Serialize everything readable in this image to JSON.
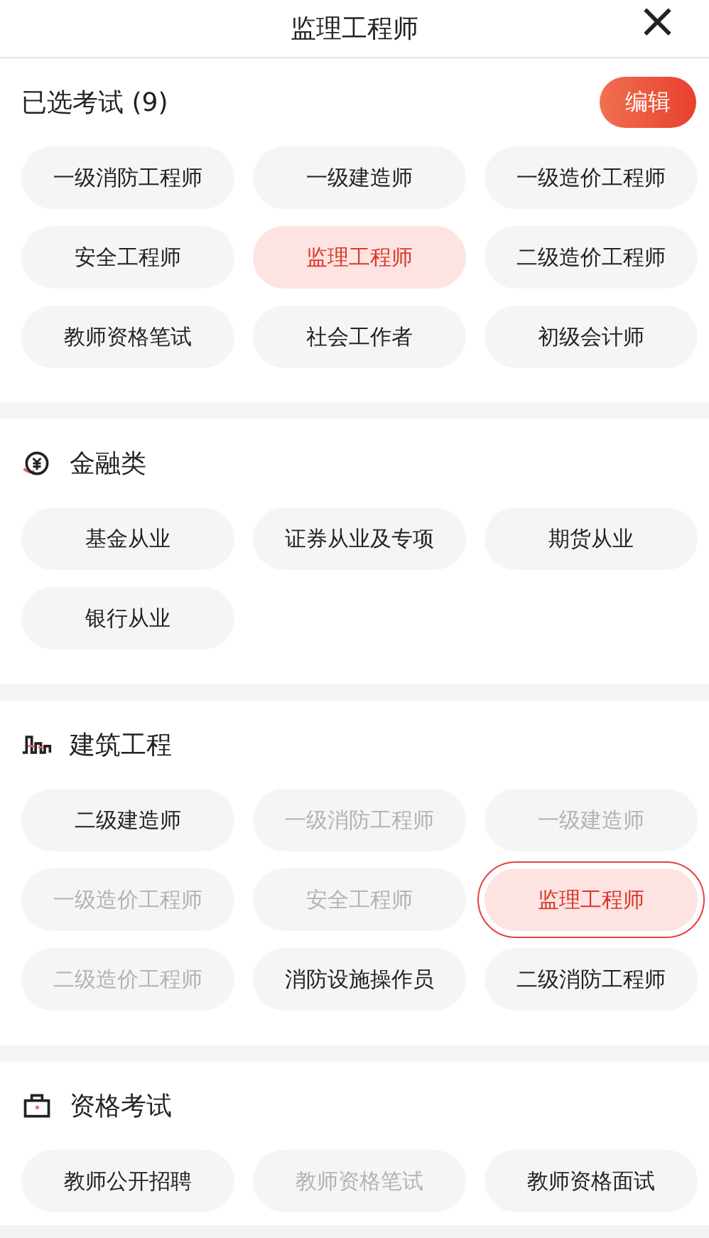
{
  "header": {
    "title": "监理工程师",
    "close": "×"
  },
  "chosen": {
    "title": "已选考试 (9)",
    "edit_button": "编辑",
    "items": [
      {
        "label": "一级消防工程师",
        "selected": false
      },
      {
        "label": "一级建造师",
        "selected": false
      },
      {
        "label": "一级造价工程师",
        "selected": false
      },
      {
        "label": "安全工程师",
        "selected": false
      },
      {
        "label": "监理工程师",
        "selected": true
      },
      {
        "label": "二级造价工程师",
        "selected": false
      },
      {
        "label": "教师资格笔试",
        "selected": false
      },
      {
        "label": "社会工作者",
        "selected": false
      },
      {
        "label": "初级会计师",
        "selected": false
      }
    ]
  },
  "categories": [
    {
      "title": "金融类",
      "kind": "finance",
      "items": [
        {
          "label": "基金从业",
          "selected": false,
          "disabled": false,
          "outlined": false
        },
        {
          "label": "证券从业及专项",
          "selected": false,
          "disabled": false,
          "outlined": false
        },
        {
          "label": "期货从业",
          "selected": false,
          "disabled": false,
          "outlined": false
        },
        {
          "label": "银行从业",
          "selected": false,
          "disabled": false,
          "outlined": false
        }
      ]
    },
    {
      "title": "建筑工程",
      "kind": "building",
      "items": [
        {
          "label": "二级建造师",
          "selected": false,
          "disabled": false,
          "outlined": false
        },
        {
          "label": "一级消防工程师",
          "selected": false,
          "disabled": true,
          "outlined": false
        },
        {
          "label": "一级建造师",
          "selected": false,
          "disabled": true,
          "outlined": false
        },
        {
          "label": "一级造价工程师",
          "selected": false,
          "disabled": true,
          "outlined": false
        },
        {
          "label": "安全工程师",
          "selected": false,
          "disabled": true,
          "outlined": false
        },
        {
          "label": "监理工程师",
          "selected": true,
          "disabled": false,
          "outlined": true
        },
        {
          "label": "二级造价工程师",
          "selected": false,
          "disabled": true,
          "outlined": false
        },
        {
          "label": "消防设施操作员",
          "selected": false,
          "disabled": false,
          "outlined": false
        },
        {
          "label": "二级消防工程师",
          "selected": false,
          "disabled": false,
          "outlined": false
        }
      ]
    },
    {
      "title": "资格考试",
      "kind": "qualification",
      "items": [
        {
          "label": "教师公开招聘",
          "selected": false,
          "disabled": false,
          "outlined": false
        },
        {
          "label": "教师资格笔试",
          "selected": false,
          "disabled": true,
          "outlined": false
        },
        {
          "label": "教师资格面试",
          "selected": false,
          "disabled": false,
          "outlined": false
        }
      ]
    }
  ]
}
